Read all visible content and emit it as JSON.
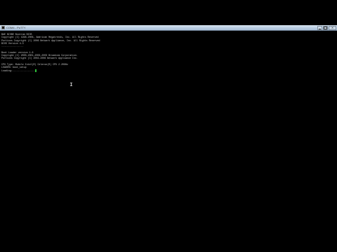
{
  "window": {
    "title": "COM4 - PuTTY"
  },
  "console": {
    "lines": [
      "BAE NIOBE Bootrom BIOS",
      "Copyright (C) 1996-2006, American Megatrends, Inc. All Rights Reserved",
      "Portions Copyright (C) 2006 Network Appliance, Inc. All Rights Reserved",
      "BIOS Version 4.3",
      "................",
      "",
      "Boot Loader version 1.6",
      "Copyright (C) 2000,2001,2002,2003 Broadcom Corporation.",
      "Portions Copyright (C) 2002-2006 Network Appliance Inc.",
      "",
      "CPU Type: Mobile Intel(R) Celeron(R) CPU 2.20GHz",
      "LOADER> boot_setup",
      "Loading:................"
    ]
  },
  "colors": {
    "text": "#c8c8c8",
    "cursor": "#2fbf3a",
    "background": "#000000"
  },
  "icons": {
    "window_icon": "terminal-icon",
    "minimize": "minimize-icon",
    "maximize": "maximize-icon",
    "close": "close-icon"
  }
}
